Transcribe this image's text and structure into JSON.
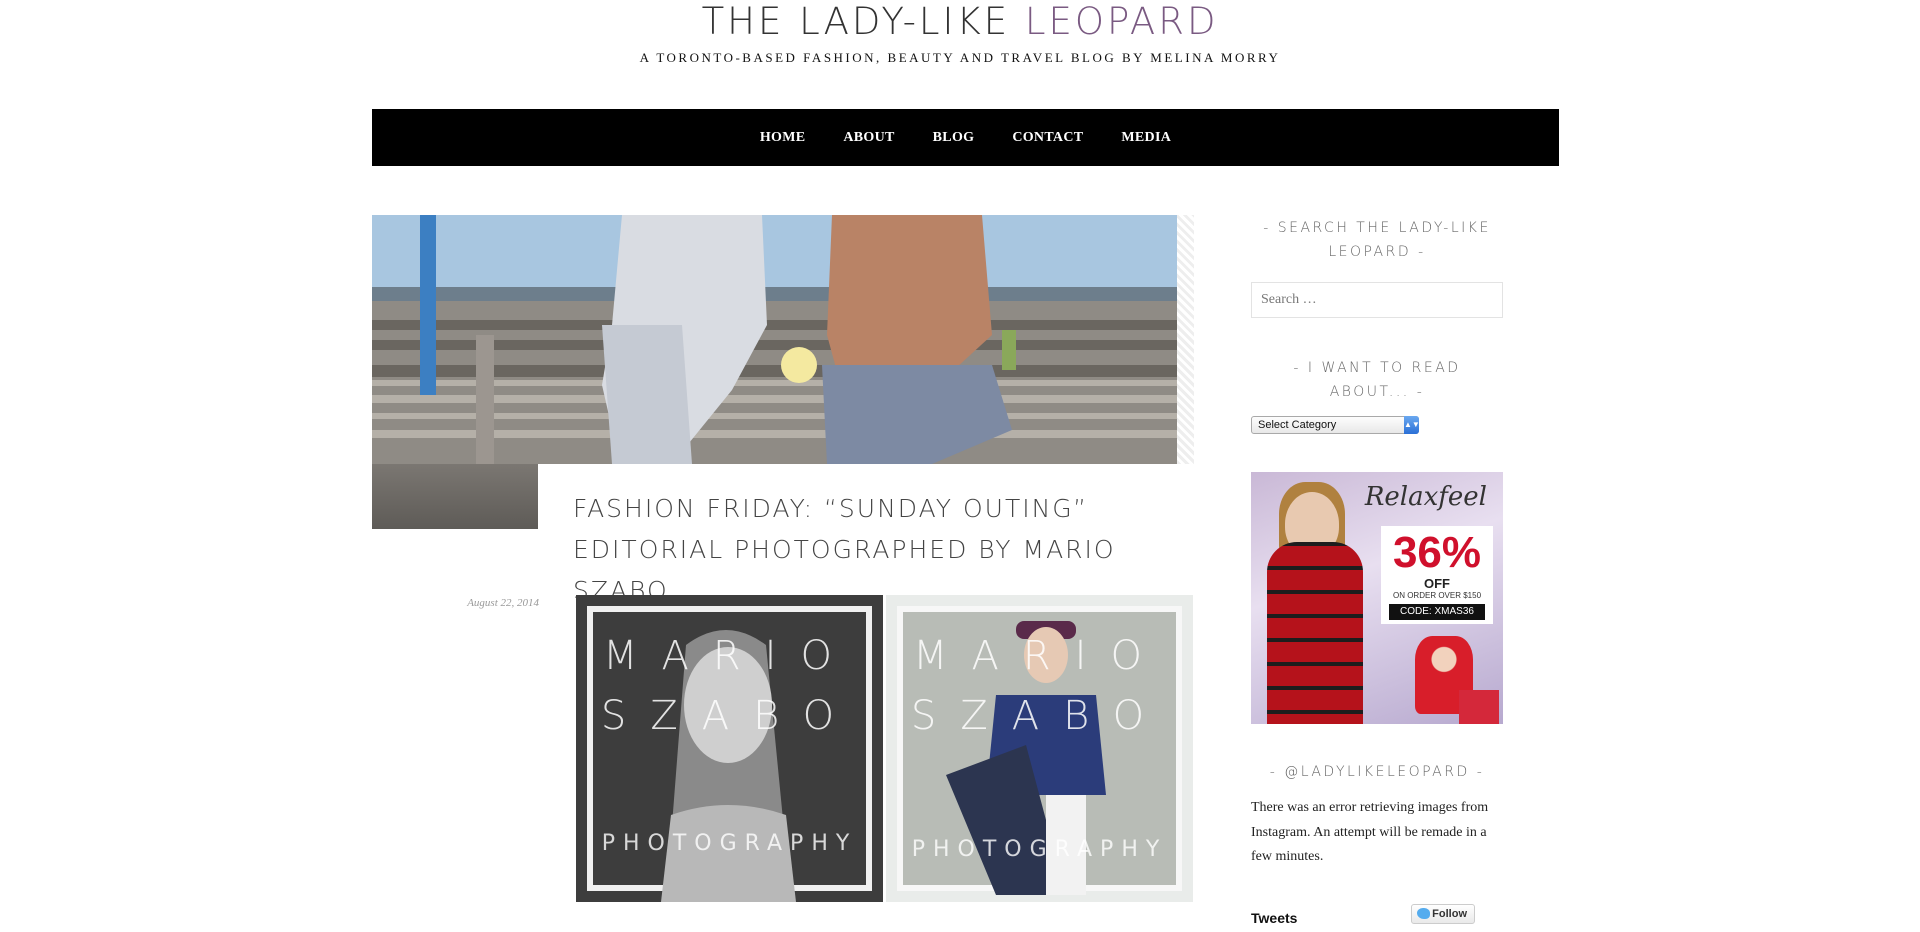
{
  "site": {
    "title_part1": "THE LADY-LIKE ",
    "title_part2": "LEOPARD",
    "tagline": "A TORONTO-BASED FASHION, BEAUTY AND TRAVEL BLOG BY MELINA MORRY"
  },
  "nav": {
    "items": [
      {
        "label": "HOME"
      },
      {
        "label": "ABOUT"
      },
      {
        "label": "BLOG"
      },
      {
        "label": "CONTACT"
      },
      {
        "label": "MEDIA"
      }
    ]
  },
  "post": {
    "title": "FASHION FRIDAY: “SUNDAY OUTING” EDITORIAL PHOTOGRAPHED BY MARIO SZABO",
    "date": "August 22, 2014",
    "photo_watermark_line1": "MARIO",
    "photo_watermark_line2": "SZABO",
    "photo_watermark_line3": "PHOTOGRAPHY"
  },
  "sidebar": {
    "search_title": "- SEARCH THE LADY-LIKE LEOPARD -",
    "search_placeholder": "Search …",
    "category_title": "- I WANT TO READ ABOUT... -",
    "category_selected": "Select Category",
    "ad": {
      "brand": "Relaxfeel",
      "percent": "36%",
      "off": "OFF",
      "order_text": "ON ORDER OVER $150",
      "code": "CODE: XMAS36"
    },
    "instagram_title": "- @LADYLIKELEOPARD -",
    "instagram_error": "There was an error retrieving images from Instagram. An attempt will be remade in a few minutes.",
    "tweets_label": "Tweets",
    "follow_label": "Follow"
  },
  "colors": {
    "nav_bg": "#000000",
    "title_accent": "#7a5a82"
  }
}
